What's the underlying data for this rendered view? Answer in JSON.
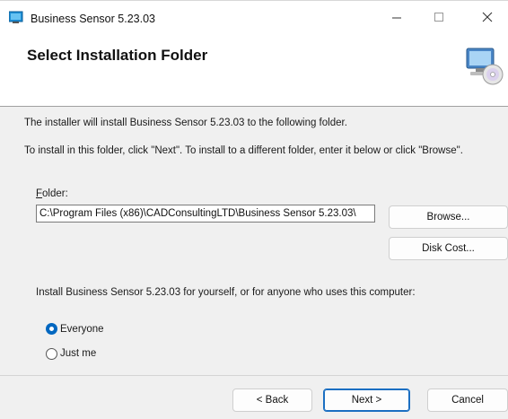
{
  "window": {
    "title": "Business Sensor 5.23.03",
    "minimize_glyph": "—",
    "maximize_glyph": "☐",
    "close_glyph": "✕"
  },
  "header": {
    "title": "Select Installation Folder",
    "icon": "computer-cd-setup-icon"
  },
  "body": {
    "intro": "The installer will install Business Sensor 5.23.03 to the following folder.",
    "instructions": "To install in this folder, click \"Next\". To install to a different folder, enter it below or click \"Browse\".",
    "folder_label_accel": "F",
    "folder_label_rest": "older:",
    "folder_value": "C:\\Program Files (x86)\\CADConsultingLTD\\Business Sensor 5.23.03\\",
    "browse_label": "Browse...",
    "disk_cost_label": "Disk Cost...",
    "scope_prompt": "Install Business Sensor 5.23.03 for yourself, or for anyone who uses this computer:",
    "options": [
      {
        "label": "Everyone",
        "selected": true
      },
      {
        "label": "Just me",
        "selected": false
      }
    ]
  },
  "footer": {
    "back_label": "< Back",
    "next_label": "Next >",
    "cancel_label": "Cancel"
  },
  "colors": {
    "accent": "#0067c0",
    "dialog_bg": "#f0f0f0",
    "header_bg": "#ffffff"
  }
}
